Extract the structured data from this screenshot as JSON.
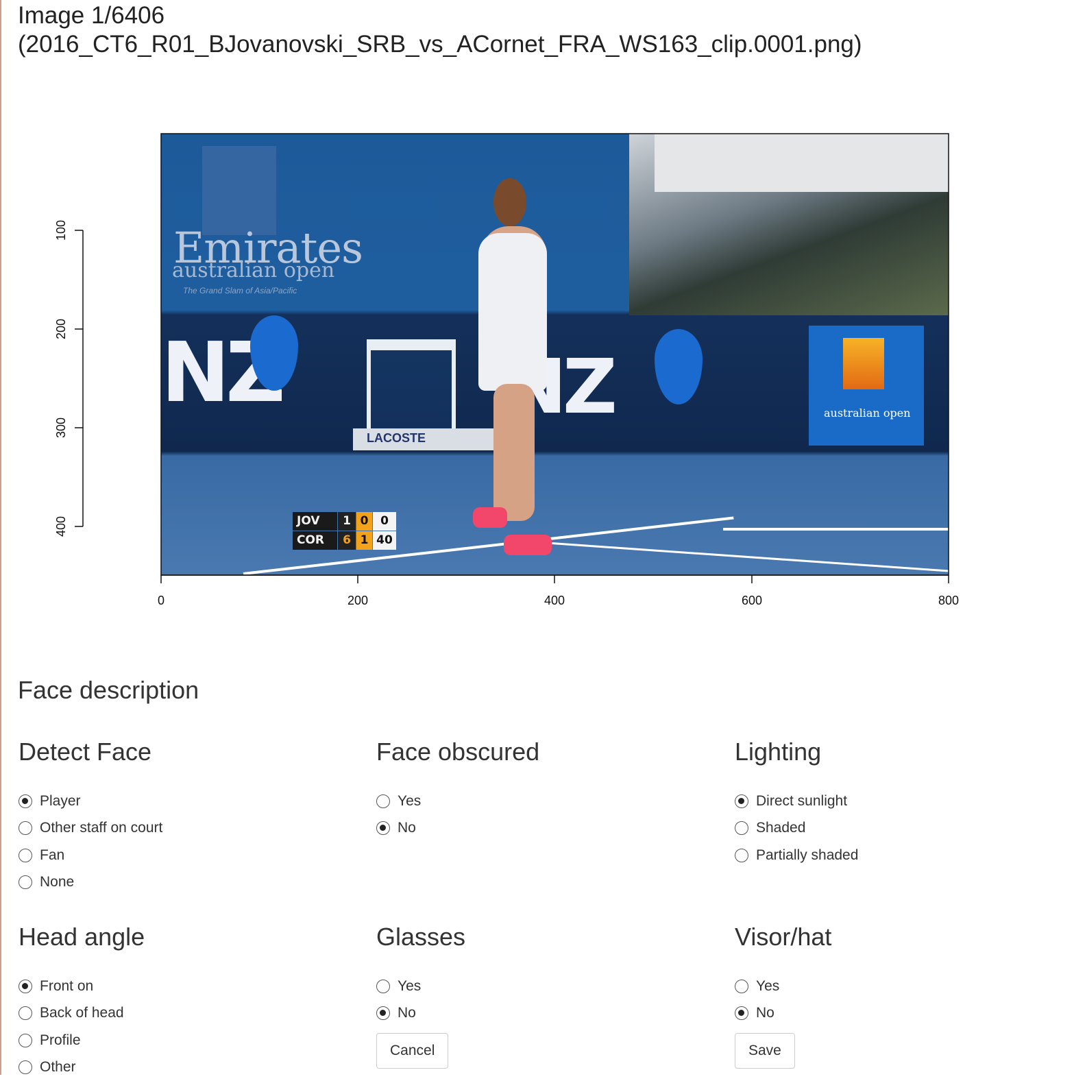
{
  "header": {
    "title_line1": "Image 1/6406",
    "title_line2": "(2016_CT6_R01_BJovanovski_SRB_vs_ACornet_FRA_WS163_clip.0001.png)"
  },
  "image": {
    "emirates_text": "Emirates",
    "australian_open_text": "australian open",
    "tagline": "The Grand Slam of Asia/Pacific",
    "anz_text": "NZ",
    "banner_text": "LACOSTE",
    "panel_text": "australian open",
    "scoreboard": [
      {
        "name": "JOV",
        "sets": "1",
        "games": "0",
        "points": "0"
      },
      {
        "name": "COR",
        "sets": "6",
        "games": "1",
        "points": "40"
      }
    ]
  },
  "axes": {
    "x_ticks": [
      "0",
      "200",
      "400",
      "600",
      "800"
    ],
    "y_ticks": [
      "100",
      "200",
      "300",
      "400"
    ]
  },
  "form": {
    "section_title": "Face description",
    "groups": {
      "detect_face": {
        "title": "Detect Face",
        "options": [
          "Player",
          "Other staff on court",
          "Fan",
          "None"
        ],
        "selected": "Player"
      },
      "face_obscured": {
        "title": "Face obscured",
        "options": [
          "Yes",
          "No"
        ],
        "selected": "No"
      },
      "lighting": {
        "title": "Lighting",
        "options": [
          "Direct sunlight",
          "Shaded",
          "Partially shaded"
        ],
        "selected": "Direct sunlight"
      },
      "head_angle": {
        "title": "Head angle",
        "options": [
          "Front on",
          "Back of head",
          "Profile",
          "Other"
        ],
        "selected": "Front on"
      },
      "glasses": {
        "title": "Glasses",
        "options": [
          "Yes",
          "No"
        ],
        "selected": "No"
      },
      "visor_hat": {
        "title": "Visor/hat",
        "options": [
          "Yes",
          "No"
        ],
        "selected": "No"
      }
    },
    "cancel_label": "Cancel",
    "save_label": "Save"
  }
}
